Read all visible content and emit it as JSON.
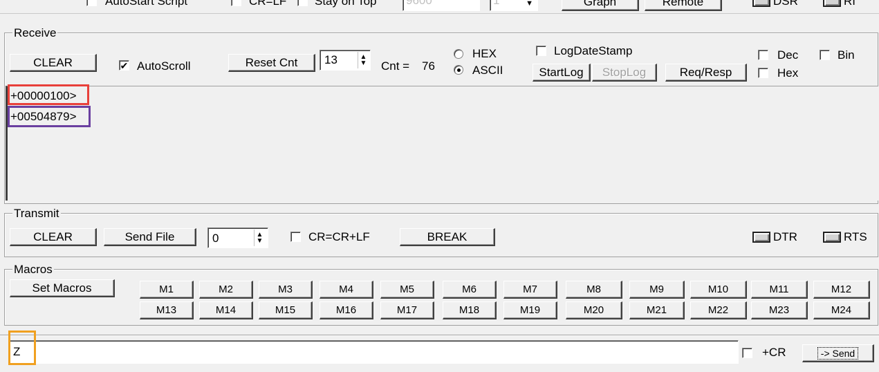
{
  "top_strip": {
    "autostart_label": "AutoStart Script",
    "crlf_label": "CR=LF",
    "stay_on_top_label": "Stay on Top",
    "baud_value": "9600",
    "small_value": "1",
    "graph_label": "Graph",
    "remote_label": "Remote",
    "dsr_label": "DSR",
    "ri_label": "RI"
  },
  "receive": {
    "title": "Receive",
    "clear_label": "CLEAR",
    "autoscroll_label": "AutoScroll",
    "autoscroll_checked": true,
    "reset_cnt_label": "Reset Cnt",
    "cnt_spin_value": "13",
    "cnt_text": "Cnt =",
    "cnt_value": "76",
    "hex_label": "HEX",
    "ascii_label": "ASCII",
    "mode_selected": "ASCII",
    "logdatestamp_label": "LogDateStamp",
    "startlog_label": "StartLog",
    "stoplog_label": "StopLog",
    "reqresp_label": "Req/Resp",
    "dec_label": "Dec",
    "bin_label": "Bin",
    "hex_check_label": "Hex",
    "lines": [
      "+00000100>",
      "+00504879>"
    ]
  },
  "transmit": {
    "title": "Transmit",
    "clear_label": "CLEAR",
    "sendfile_label": "Send File",
    "spin_value": "0",
    "crcrlf_label": "CR=CR+LF",
    "break_label": "BREAK",
    "dtr_label": "DTR",
    "rts_label": "RTS"
  },
  "macros": {
    "title": "Macros",
    "set_label": "Set Macros",
    "row1": [
      "M1",
      "M2",
      "M3",
      "M4",
      "M5",
      "M6",
      "M7",
      "M8",
      "M9",
      "M10",
      "M11",
      "M12"
    ],
    "row2": [
      "M13",
      "M14",
      "M15",
      "M16",
      "M17",
      "M18",
      "M19",
      "M20",
      "M21",
      "M22",
      "M23",
      "M24"
    ]
  },
  "send_bar": {
    "input_value": "Z",
    "cr_label": "+CR",
    "send_label": "-> Send"
  },
  "highlight_colors": {
    "line1": "#e8403a",
    "line2": "#6a3fa0",
    "input": "#f0a020"
  }
}
